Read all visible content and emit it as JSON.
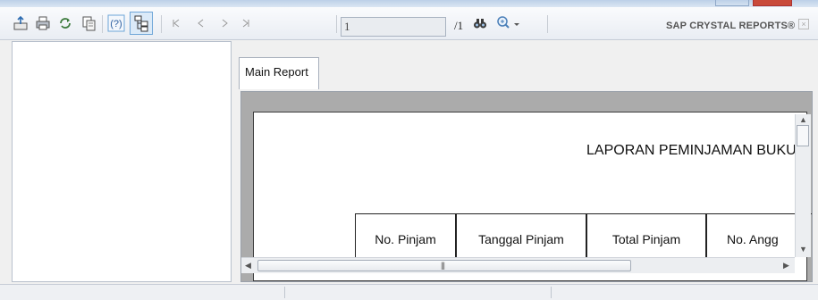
{
  "toolbar": {
    "icons": [
      "export-icon",
      "print-icon",
      "refresh-icon",
      "copy-icon",
      "help-icon",
      "group-tree-icon",
      "first-page-icon",
      "previous-page-icon",
      "next-page-icon",
      "last-page-icon",
      "find-icon",
      "zoom-icon"
    ],
    "current_page": "1",
    "total_pages": "/1",
    "brand": "SAP CRYSTAL REPORTS®"
  },
  "tabs": {
    "main_report": "Main Report"
  },
  "report": {
    "title": "LAPORAN PEMINJAMAN BUKU",
    "columns": [
      "No. Pinjam",
      "Tanggal Pinjam",
      "Total Pinjam",
      "No. Angg"
    ]
  },
  "colors": {
    "accent": "#6ea6d8",
    "viewport_bg": "#ababab",
    "page_bg": "#ffffff"
  }
}
